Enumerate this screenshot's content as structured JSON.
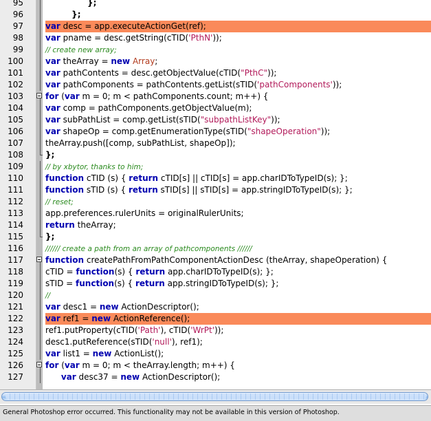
{
  "editor": {
    "highlighted_lines": [
      97,
      122
    ],
    "lines": [
      {
        "n": "95",
        "fold": "line",
        "tokens": [
          {
            "t": "                "
          },
          {
            "t": "};",
            "c": "op"
          }
        ]
      },
      {
        "n": "96",
        "fold": "line",
        "tokens": [
          {
            "t": "          "
          },
          {
            "t": "};",
            "c": "op"
          }
        ]
      },
      {
        "n": "97",
        "fold": "line",
        "tokens": [
          {
            "t": "var",
            "c": "kw"
          },
          {
            "t": " desc = app.executeActionGet(ref);"
          }
        ]
      },
      {
        "n": "98",
        "fold": "line",
        "tokens": [
          {
            "t": "var",
            "c": "kw"
          },
          {
            "t": " pname = desc.getString(cTID("
          },
          {
            "t": "'PthN'",
            "c": "str"
          },
          {
            "t": "));"
          }
        ]
      },
      {
        "n": "99",
        "fold": "line",
        "tokens": [
          {
            "t": "// create new array;",
            "c": "cmt"
          }
        ]
      },
      {
        "n": "100",
        "fold": "line",
        "tokens": [
          {
            "t": "var",
            "c": "kw"
          },
          {
            "t": " theArray = "
          },
          {
            "t": "new",
            "c": "kw"
          },
          {
            "t": " "
          },
          {
            "t": "Array",
            "c": "ty"
          },
          {
            "t": ";"
          }
        ]
      },
      {
        "n": "101",
        "fold": "line",
        "tokens": [
          {
            "t": "var",
            "c": "kw"
          },
          {
            "t": " pathContents = desc.getObjectValue(cTID("
          },
          {
            "t": "\"PthC\"",
            "c": "str"
          },
          {
            "t": "));"
          }
        ]
      },
      {
        "n": "102",
        "fold": "line",
        "tokens": [
          {
            "t": "var",
            "c": "kw"
          },
          {
            "t": " pathComponents = pathContents.getList(sTID("
          },
          {
            "t": "'pathComponents'",
            "c": "str"
          },
          {
            "t": "));"
          }
        ]
      },
      {
        "n": "103",
        "fold": "start",
        "tokens": [
          {
            "t": "for",
            "c": "kw"
          },
          {
            "t": " ("
          },
          {
            "t": "var",
            "c": "kw"
          },
          {
            "t": " m = 0; m < pathComponents.count; m++) {"
          }
        ]
      },
      {
        "n": "104",
        "fold": "line",
        "tokens": [
          {
            "t": "var",
            "c": "kw"
          },
          {
            "t": " comp = pathComponents.getObjectValue(m);"
          }
        ]
      },
      {
        "n": "105",
        "fold": "line",
        "tokens": [
          {
            "t": "var",
            "c": "kw"
          },
          {
            "t": " subPathList = comp.getList(sTID("
          },
          {
            "t": "\"subpathListKey\"",
            "c": "str"
          },
          {
            "t": "));"
          }
        ]
      },
      {
        "n": "106",
        "fold": "line",
        "tokens": [
          {
            "t": "var",
            "c": "kw"
          },
          {
            "t": " shapeOp = comp.getEnumerationType(sTID("
          },
          {
            "t": "\"shapeOperation\"",
            "c": "str"
          },
          {
            "t": "));"
          }
        ]
      },
      {
        "n": "107",
        "fold": "line",
        "tokens": [
          {
            "t": "theArray.push([comp, subPathList, shapeOp]);"
          }
        ]
      },
      {
        "n": "108",
        "fold": "end",
        "tokens": [
          {
            "t": "};",
            "c": "op"
          }
        ]
      },
      {
        "n": "109",
        "fold": "line",
        "tokens": [
          {
            "t": "// by xbytor, thanks to him;",
            "c": "cmt"
          }
        ]
      },
      {
        "n": "110",
        "fold": "line",
        "tokens": [
          {
            "t": "function",
            "c": "kw"
          },
          {
            "t": " cTID (s) { "
          },
          {
            "t": "return",
            "c": "kw"
          },
          {
            "t": " cTID[s] || cTID[s] = app.charIDToTypeID(s); };"
          }
        ]
      },
      {
        "n": "111",
        "fold": "line",
        "tokens": [
          {
            "t": "function",
            "c": "kw"
          },
          {
            "t": " sTID (s) { "
          },
          {
            "t": "return",
            "c": "kw"
          },
          {
            "t": " sTID[s] || sTID[s] = app.stringIDToTypeID(s); };"
          }
        ]
      },
      {
        "n": "112",
        "fold": "line",
        "tokens": [
          {
            "t": "// reset;",
            "c": "cmt"
          }
        ]
      },
      {
        "n": "113",
        "fold": "line",
        "tokens": [
          {
            "t": "app.preferences.rulerUnits = originalRulerUnits;"
          }
        ]
      },
      {
        "n": "114",
        "fold": "line",
        "tokens": [
          {
            "t": "return",
            "c": "kw"
          },
          {
            "t": " theArray;"
          }
        ]
      },
      {
        "n": "115",
        "fold": "end",
        "tokens": [
          {
            "t": "};",
            "c": "op"
          }
        ]
      },
      {
        "n": "116",
        "fold": "none",
        "tokens": [
          {
            "t": "////// create a path from an array of pathcomponents //////",
            "c": "cmt"
          }
        ]
      },
      {
        "n": "117",
        "fold": "start",
        "tokens": [
          {
            "t": "function",
            "c": "kw"
          },
          {
            "t": " createPathFromPathComponentActionDesc (theArray, shapeOperation) {"
          }
        ]
      },
      {
        "n": "118",
        "fold": "line",
        "tokens": [
          {
            "t": "cTID = "
          },
          {
            "t": "function",
            "c": "kw"
          },
          {
            "t": "(s) { "
          },
          {
            "t": "return",
            "c": "kw"
          },
          {
            "t": " app.charIDToTypeID(s); };"
          }
        ]
      },
      {
        "n": "119",
        "fold": "line",
        "tokens": [
          {
            "t": "sTID = "
          },
          {
            "t": "function",
            "c": "kw"
          },
          {
            "t": "(s) { "
          },
          {
            "t": "return",
            "c": "kw"
          },
          {
            "t": " app.stringIDToTypeID(s); };"
          }
        ]
      },
      {
        "n": "120",
        "fold": "line",
        "tokens": [
          {
            "t": "//",
            "c": "cmt"
          }
        ]
      },
      {
        "n": "121",
        "fold": "line",
        "tokens": [
          {
            "t": "var",
            "c": "kw"
          },
          {
            "t": " desc1 = "
          },
          {
            "t": "new",
            "c": "kw"
          },
          {
            "t": " ActionDescriptor();"
          }
        ]
      },
      {
        "n": "122",
        "fold": "line",
        "tokens": [
          {
            "t": "var",
            "c": "kw"
          },
          {
            "t": " ref1 = "
          },
          {
            "t": "new",
            "c": "kw"
          },
          {
            "t": " ActionReference();"
          }
        ]
      },
      {
        "n": "123",
        "fold": "line",
        "tokens": [
          {
            "t": "ref1.putProperty(cTID("
          },
          {
            "t": "'Path'",
            "c": "str"
          },
          {
            "t": "), cTID("
          },
          {
            "t": "'WrPt'",
            "c": "str"
          },
          {
            "t": "));"
          }
        ]
      },
      {
        "n": "124",
        "fold": "line",
        "tokens": [
          {
            "t": "desc1.putReference(sTID("
          },
          {
            "t": "'null'",
            "c": "str"
          },
          {
            "t": "), ref1);"
          }
        ]
      },
      {
        "n": "125",
        "fold": "line",
        "tokens": [
          {
            "t": "var",
            "c": "kw"
          },
          {
            "t": " list1 = "
          },
          {
            "t": "new",
            "c": "kw"
          },
          {
            "t": " ActionList();"
          }
        ]
      },
      {
        "n": "126",
        "fold": "start",
        "tokens": [
          {
            "t": "for",
            "c": "kw"
          },
          {
            "t": " ("
          },
          {
            "t": "var",
            "c": "kw"
          },
          {
            "t": " m = 0; m < theArray.length; m++) {"
          }
        ]
      },
      {
        "n": "127",
        "fold": "line",
        "tokens": [
          {
            "t": "      "
          },
          {
            "t": "var",
            "c": "kw"
          },
          {
            "t": " desc37 = "
          },
          {
            "t": "new",
            "c": "kw"
          },
          {
            "t": " ActionDescriptor();"
          }
        ]
      }
    ]
  },
  "status_bar": {
    "message": "General Photoshop error occurred. This functionality may not be available in this version of Photoshop."
  },
  "colors": {
    "highlight": "#fa8a5a",
    "keyword": "#0000b0",
    "string": "#b21a5a",
    "comment": "#2a8a1e"
  }
}
